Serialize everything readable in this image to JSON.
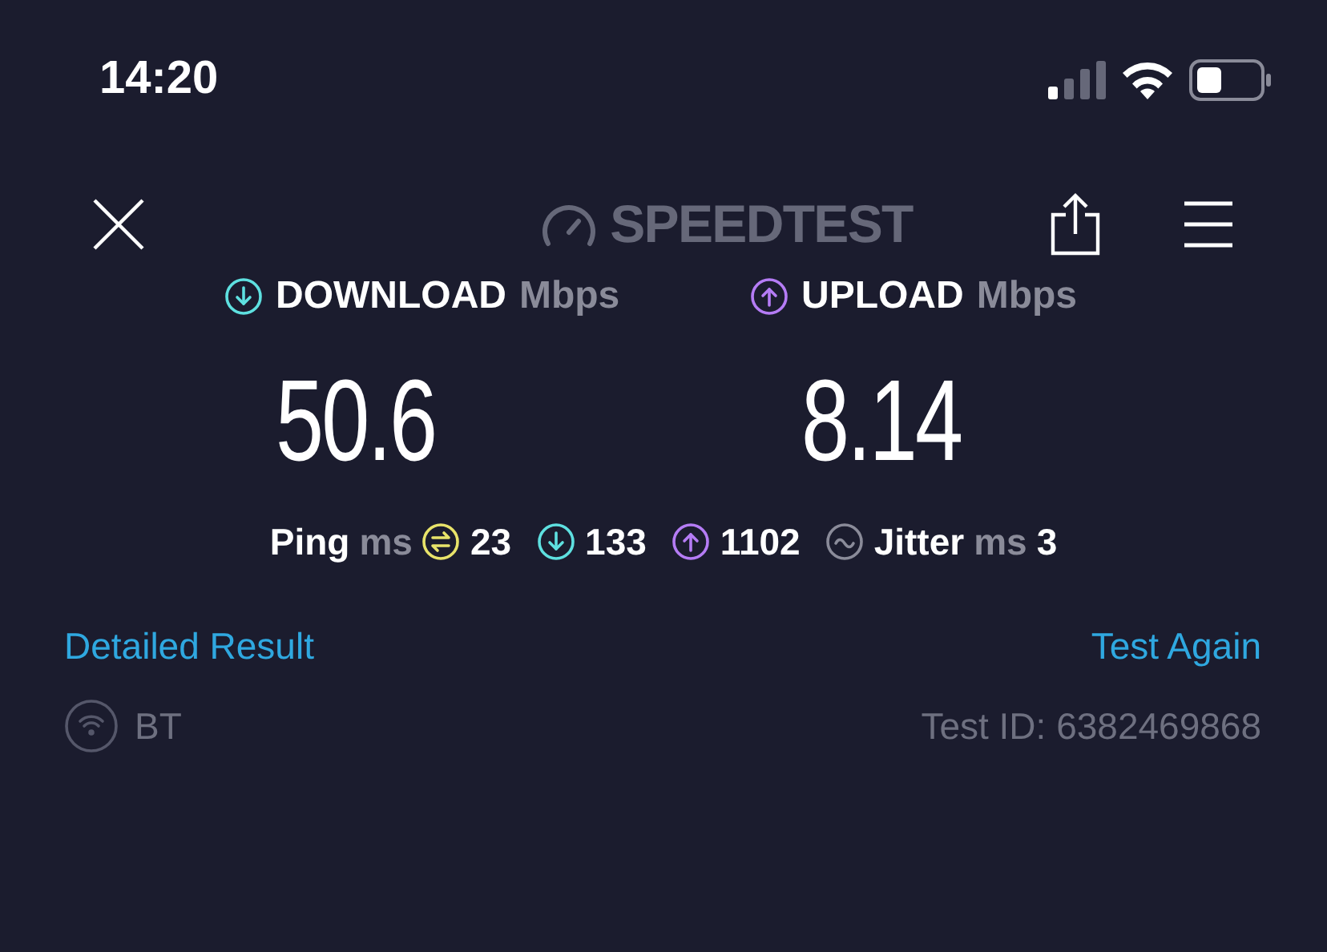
{
  "status_bar": {
    "time": "14:20"
  },
  "header": {
    "logo": "SPEEDTEST"
  },
  "metrics": [
    {
      "kind": "download",
      "label": "DOWNLOAD",
      "unit": "Mbps",
      "value": "50.6"
    },
    {
      "kind": "upload",
      "label": "UPLOAD",
      "unit": "Mbps",
      "value": "8.14"
    }
  ],
  "latency": [
    {
      "kind": "ping",
      "label": "Ping",
      "unit": "ms",
      "value": "23"
    },
    {
      "kind": "download",
      "value": "133"
    },
    {
      "kind": "upload",
      "value": "1102"
    },
    {
      "kind": "jitter",
      "label": "Jitter",
      "unit": "ms",
      "value": "3"
    }
  ],
  "links": {
    "left": "Detailed Result",
    "right": "Test Again"
  },
  "footer": {
    "provider": "BT",
    "test_id": "Test ID: 6382469868"
  }
}
